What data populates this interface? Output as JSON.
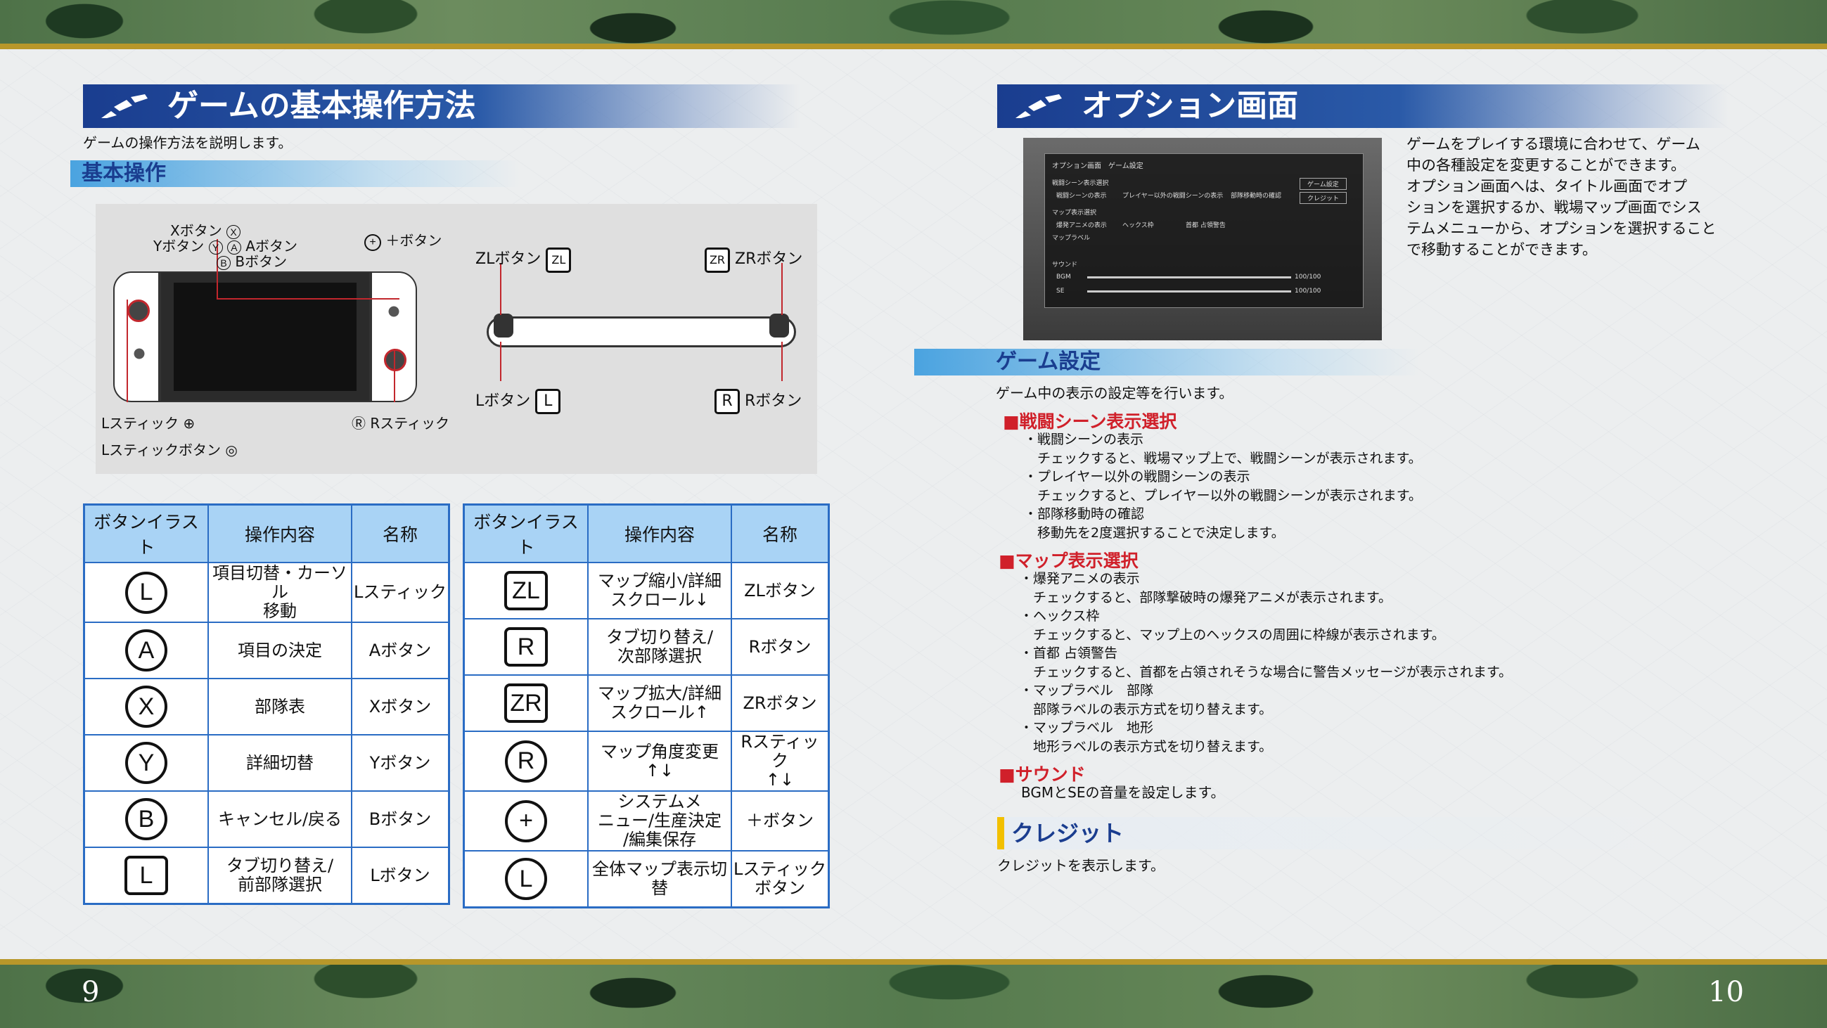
{
  "left": {
    "title": "ゲームの基本操作方法",
    "intro": "ゲームの操作方法を説明します。",
    "section": "基本操作",
    "diagram": {
      "x_button": "Xボタン",
      "y_button": "Yボタン",
      "a_button": "Aボタン",
      "b_button": "Bボタン",
      "plus_button": "＋ボタン",
      "l_stick": "Lスティック",
      "l_stick_button": "Lスティックボタン",
      "r_stick": "Rスティック",
      "zl_button": "ZLボタン",
      "zr_button": "ZRボタン",
      "l_button": "Lボタン",
      "r_button": "Rボタン",
      "glyph_x": "X",
      "glyph_y": "Y",
      "glyph_a": "A",
      "glyph_b": "B",
      "glyph_zl": "ZL",
      "glyph_zr": "ZR",
      "glyph_l": "L",
      "glyph_r": "R"
    },
    "table_headers": [
      "ボタンイラスト",
      "操作内容",
      "名称"
    ],
    "table1": [
      {
        "icon": "L",
        "action": "項目切替・カーソル\n移動",
        "name": "Lスティック"
      },
      {
        "icon": "A",
        "action": "項目の決定",
        "name": "Aボタン"
      },
      {
        "icon": "X",
        "action": "部隊表",
        "name": "Xボタン"
      },
      {
        "icon": "Y",
        "action": "詳細切替",
        "name": "Yボタン"
      },
      {
        "icon": "B",
        "action": "キャンセル/戻る",
        "name": "Bボタン"
      },
      {
        "icon": "L",
        "action": "タブ切り替え/\n前部隊選択",
        "name": "Lボタン"
      }
    ],
    "table2": [
      {
        "icon": "ZL",
        "action": "マップ縮小/詳細\nスクロール↓",
        "name": "ZLボタン"
      },
      {
        "icon": "R",
        "action": "タブ切り替え/\n次部隊選択",
        "name": "Rボタン"
      },
      {
        "icon": "ZR",
        "action": "マップ拡大/詳細\nスクロール↑",
        "name": "ZRボタン"
      },
      {
        "icon": "R",
        "action": "マップ角度変更\n↑↓",
        "name": "Rスティック\n↑↓"
      },
      {
        "icon": "+",
        "action": "システムメ\nニュー/生産決定\n/編集保存",
        "name": "＋ボタン"
      },
      {
        "icon": "L",
        "action": "全体マップ表示切替",
        "name": "Lスティック\nボタン"
      }
    ],
    "page_number": "9"
  },
  "right": {
    "title": "オプション画面",
    "description": "ゲームをプレイする環境に合わせて、ゲーム\n中の各種設定を変更することができます。\nオプション画面へは、タイトル画面でオプ\nションを選択するか、戦場マップ画面でシス\nテムメニューから、オプションを選択すること\nで移動することができます。",
    "screenshot": {
      "header": "オプション画面　ゲーム設定",
      "battle": "戦闘シーン表示選択",
      "opt1": "戦闘シーンの表示",
      "opt2": "プレイヤー以外の戦闘シーンの表示",
      "opt3": "部隊移動時の確認",
      "map": "マップ表示選択",
      "opt4": "爆発アニメの表示",
      "opt5": "ヘックス枠",
      "opt6": "首都 占領警告",
      "label": "マップラベル",
      "sound": "サウンド",
      "bgm": "BGM",
      "se": "SE",
      "bgm_val": "100/100",
      "se_val": "100/100",
      "btn1": "ゲーム設定",
      "btn2": "クレジット"
    },
    "section_game": "ゲーム設定",
    "game_intro": "ゲーム中の表示の設定等を行います。",
    "h_battle": "■戦闘シーン表示選択",
    "battle_text": "・戦闘シーンの表示\n　チェックすると、戦場マップ上で、戦闘シーンが表示されます。\n・プレイヤー以外の戦闘シーンの表示\n　チェックすると、プレイヤー以外の戦闘シーンが表示されます。\n・部隊移動時の確認\n　移動先を2度選択することで決定します。",
    "h_map": "■マップ表示選択",
    "map_text": "・爆発アニメの表示\n　チェックすると、部隊撃破時の爆発アニメが表示されます。\n・ヘックス枠\n　チェックすると、マップ上のヘックスの周囲に枠線が表示されます。\n・首都 占領警告\n　チェックすると、首都を占領されそうな場合に警告メッセージが表示されます。\n・マップラベル　部隊\n　部隊ラベルの表示方式を切り替えます。\n・マップラベル　地形\n　地形ラベルの表示方式を切り替えます。",
    "h_sound": "■サウンド",
    "sound_text": "BGMとSEの音量を設定します。",
    "section_credit": "クレジット",
    "credit_text": "クレジットを表示します。",
    "page_number": "10"
  }
}
